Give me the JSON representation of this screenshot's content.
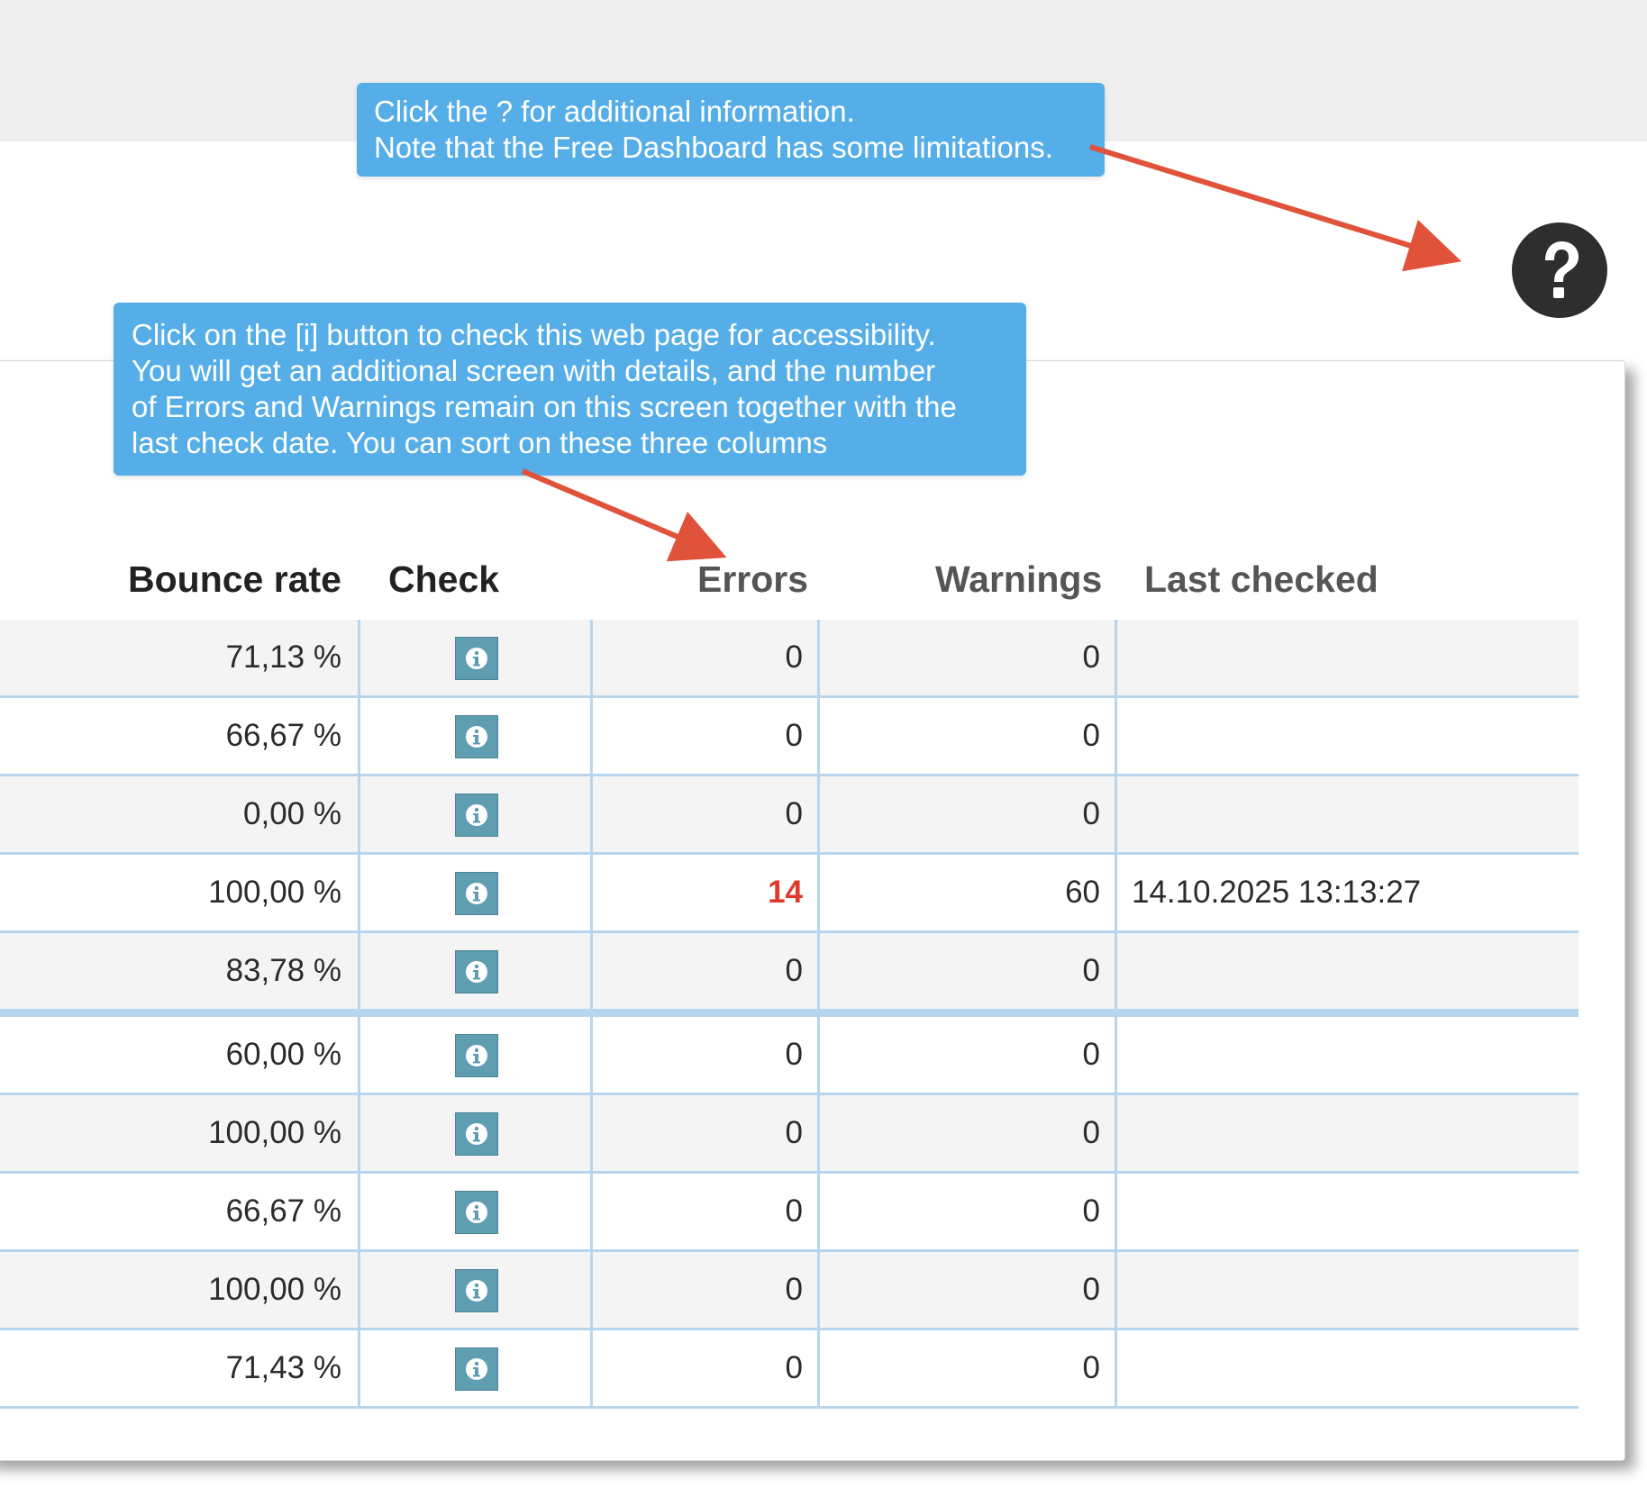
{
  "tooltips": {
    "help_tip": [
      "Click the ? for additional information.",
      "Note that the Free Dashboard has some limitations."
    ],
    "check_tip": [
      "Click on the [i] button to check this web page for accessibility.",
      "You will get an additional screen with details, and the number",
      "of Errors and Warnings remain on this screen together with the",
      "last check date. You can sort on these three columns"
    ]
  },
  "help_button": {
    "icon": "question-mark-icon"
  },
  "table": {
    "headers": {
      "bounce_rate": "Bounce rate",
      "check": "Check",
      "errors": "Errors",
      "warnings": "Warnings",
      "last_checked": "Last checked"
    },
    "rows": [
      {
        "bounce_rate": "71,13 %",
        "errors": "0",
        "warnings": "0",
        "last_checked": ""
      },
      {
        "bounce_rate": "66,67 %",
        "errors": "0",
        "warnings": "0",
        "last_checked": ""
      },
      {
        "bounce_rate": "0,00 %",
        "errors": "0",
        "warnings": "0",
        "last_checked": ""
      },
      {
        "bounce_rate": "100,00 %",
        "errors": "14",
        "warnings": "60",
        "last_checked": "14.10.2025 13:13:27"
      },
      {
        "bounce_rate": "83,78 %",
        "errors": "0",
        "warnings": "0",
        "last_checked": ""
      },
      {
        "bounce_rate": "60,00 %",
        "errors": "0",
        "warnings": "0",
        "last_checked": ""
      },
      {
        "bounce_rate": "100,00 %",
        "errors": "0",
        "warnings": "0",
        "last_checked": ""
      },
      {
        "bounce_rate": "66,67 %",
        "errors": "0",
        "warnings": "0",
        "last_checked": ""
      },
      {
        "bounce_rate": "100,00 %",
        "errors": "0",
        "warnings": "0",
        "last_checked": ""
      },
      {
        "bounce_rate": "71,43 %",
        "errors": "0",
        "warnings": "0",
        "last_checked": ""
      }
    ]
  },
  "colors": {
    "tooltip_bg": "#56aee8",
    "arrow": "#e0523a",
    "error_highlight": "#e03a2d",
    "info_button": "#5f9db0",
    "row_divider": "#b7d6ee"
  }
}
